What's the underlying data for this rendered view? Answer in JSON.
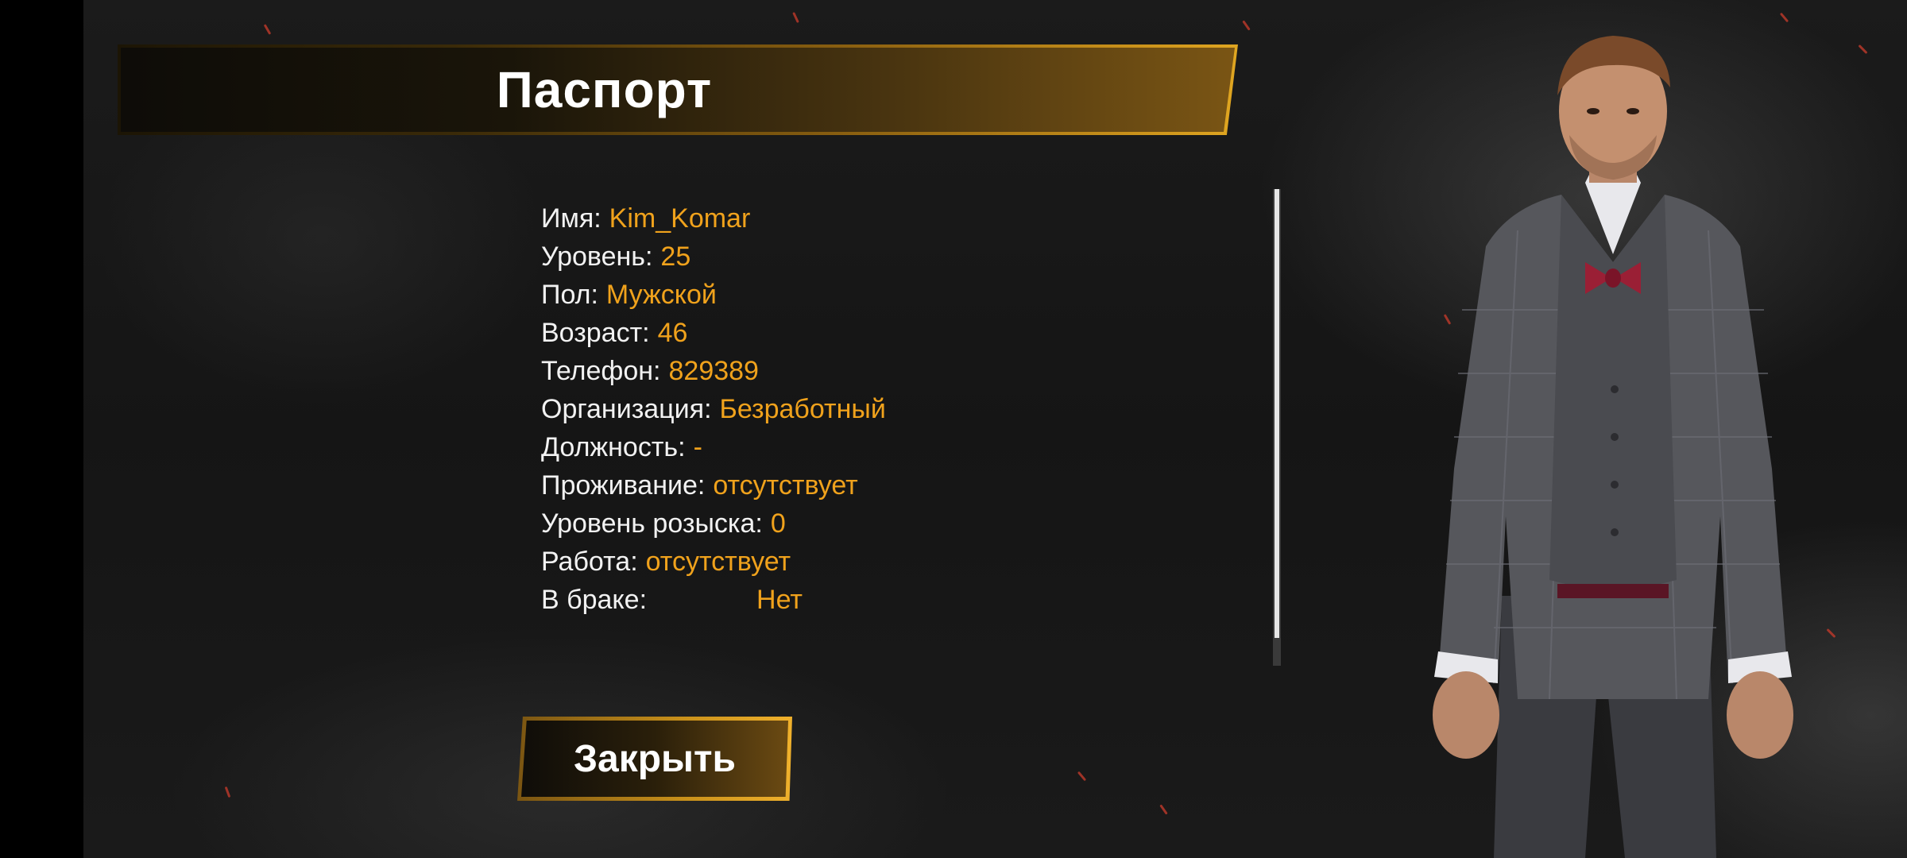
{
  "title": "Паспорт",
  "fields": [
    {
      "label": "Имя:",
      "value": "Kim_Komar"
    },
    {
      "label": "Уровень:",
      "value": "25"
    },
    {
      "label": "Пол:",
      "value": "Мужской"
    },
    {
      "label": "Возраст:",
      "value": "46"
    },
    {
      "label": "Телефон:",
      "value": "829389"
    },
    {
      "label": "Организация:",
      "value": "Безработный"
    },
    {
      "label": "Должность:",
      "value": "-"
    },
    {
      "label": "Проживание:",
      "value": "отсутствует"
    },
    {
      "label": "Уровень розыска:",
      "value": "0"
    },
    {
      "label": "Работа:",
      "value": "отсутствует"
    },
    {
      "label": "В браке:",
      "value": "Нет"
    }
  ],
  "close_button": {
    "label": "Закрыть"
  },
  "colors": {
    "accent": "#f0a21c",
    "label": "#f2f2f2",
    "background": "#151515",
    "banner_gold": "#e0a621"
  }
}
